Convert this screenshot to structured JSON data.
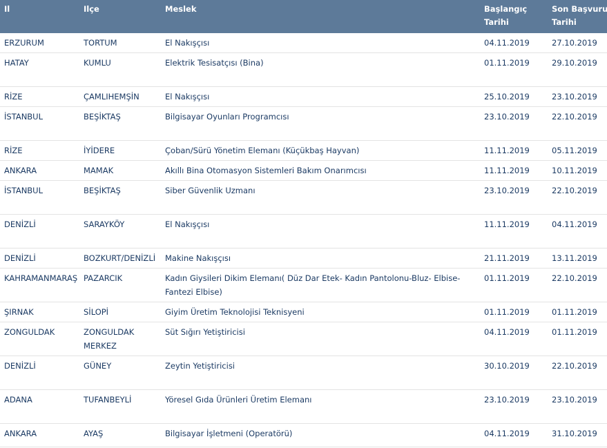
{
  "table": {
    "headers": {
      "il": "Il",
      "ilce": "Ilçe",
      "meslek": "Meslek",
      "baslangic_line1": "Başlangıç",
      "baslangic_line2": "Tarihi",
      "son_line1": "Son Başvuru",
      "son_line2": "Tarihi"
    },
    "rows": [
      {
        "il": "ERZURUM",
        "ilce": "TORTUM",
        "meslek": "El Nakışçısı",
        "baslangic": "04.11.2019",
        "son": "27.10.2019"
      },
      {
        "il": "HATAY",
        "ilce": "KUMLU",
        "meslek": "Elektrik Tesisatçısı (Bina)",
        "baslangic": "01.11.2019",
        "son": "29.10.2019"
      },
      {
        "il": "RİZE",
        "ilce": "ÇAMLIHEMŞİN",
        "meslek": "El Nakışçısı",
        "baslangic": "25.10.2019",
        "son": "23.10.2019"
      },
      {
        "il": "İSTANBUL",
        "ilce": "BEŞİKTAŞ",
        "meslek": "Bilgisayar Oyunları Programcısı",
        "baslangic": "23.10.2019",
        "son": "22.10.2019"
      },
      {
        "il": "RİZE",
        "ilce": "İYİDERE",
        "meslek": "Çoban/Sürü Yönetim Elemanı (Küçükbaş Hayvan)",
        "baslangic": "11.11.2019",
        "son": "05.11.2019"
      },
      {
        "il": "ANKARA",
        "ilce": "MAMAK",
        "meslek": "Akıllı Bina Otomasyon Sistemleri Bakım Onarımcısı",
        "baslangic": "11.11.2019",
        "son": "10.11.2019"
      },
      {
        "il": "İSTANBUL",
        "ilce": "BEŞİKTAŞ",
        "meslek": "Siber Güvenlik Uzmanı",
        "baslangic": "23.10.2019",
        "son": "22.10.2019"
      },
      {
        "il": "DENİZLİ",
        "ilce": "SARAYKÖY",
        "meslek": "El Nakışçısı",
        "baslangic": "11.11.2019",
        "son": "04.11.2019"
      },
      {
        "il": "DENİZLİ",
        "ilce": "BOZKURT/DENİZLİ",
        "meslek": "Makine Nakışçısı",
        "baslangic": "21.11.2019",
        "son": "13.11.2019"
      },
      {
        "il": "KAHRAMANMARAŞ",
        "ilce": "PAZARCIK",
        "meslek": "Kadın Giysileri Dikim Elemanı( Düz Dar Etek- Kadın Pantolonu-Bluz- Elbise-Fantezi Elbise)",
        "baslangic": "01.11.2019",
        "son": "22.10.2019"
      },
      {
        "il": "ŞIRNAK",
        "ilce": "SİLOPİ",
        "meslek": "Giyim Üretim Teknolojisi Teknisyeni",
        "baslangic": "01.11.2019",
        "son": "01.11.2019"
      },
      {
        "il": "ZONGULDAK",
        "ilce": "ZONGULDAK MERKEZ",
        "meslek": "Süt Sığırı Yetiştiricisi",
        "baslangic": "04.11.2019",
        "son": "01.11.2019"
      },
      {
        "il": "DENİZLİ",
        "ilce": "GÜNEY",
        "meslek": "Zeytin Yetiştiricisi",
        "baslangic": "30.10.2019",
        "son": "22.10.2019"
      },
      {
        "il": "ADANA",
        "ilce": "TUFANBEYLİ",
        "meslek": "Yöresel Gıda Ürünleri Üretim Elemanı",
        "baslangic": "23.10.2019",
        "son": "23.10.2019"
      },
      {
        "il": "ANKARA",
        "ilce": "AYAŞ",
        "meslek": "Bilgisayar İşletmeni (Operatörü)",
        "baslangic": "04.11.2019",
        "son": "31.10.2019"
      }
    ]
  },
  "colors": {
    "header_bg": "#5d7a99",
    "text": "#1b3a63",
    "row_border": "#e3e3e3"
  }
}
